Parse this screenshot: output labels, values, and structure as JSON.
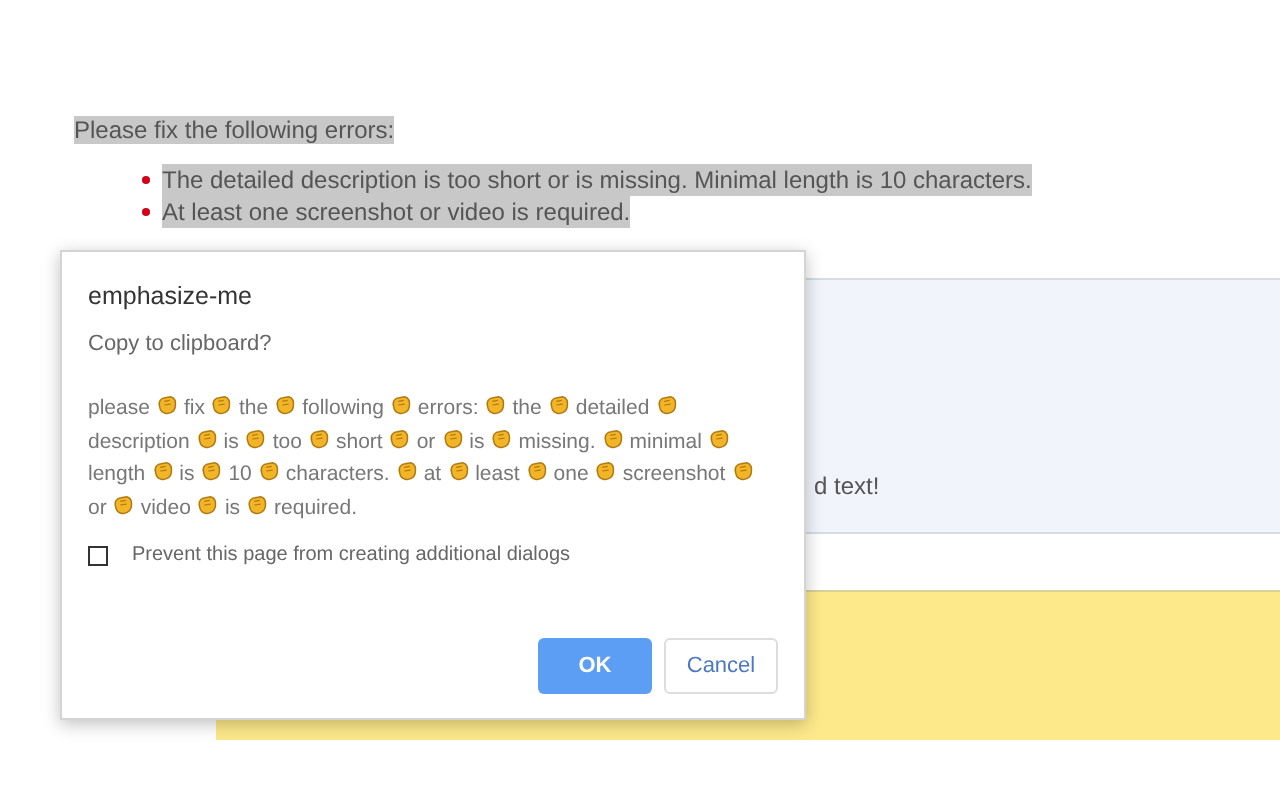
{
  "page": {
    "heading": "Please fix the following errors:",
    "errors": [
      "The detailed description is too short or is missing. Minimal length is 10 characters.",
      "At least one screenshot or video is required."
    ],
    "panel_text": "d text!"
  },
  "dialog": {
    "title": "emphasize-me",
    "question": "Copy to clipboard?",
    "message_words": [
      "please",
      "fix",
      "the",
      "following",
      "errors:",
      "the",
      "detailed",
      "description",
      "is",
      "too",
      "short",
      "or",
      "is",
      "missing.",
      "minimal",
      "length",
      "is",
      "10",
      "characters.",
      "at",
      "least",
      "one",
      "screenshot",
      "or",
      "video",
      "is",
      "required."
    ],
    "prevent_checkbox": {
      "label": "Prevent this page from creating additional dialogs",
      "checked": false
    },
    "buttons": [
      {
        "label": "OK",
        "kind": "primary"
      },
      {
        "label": "Cancel",
        "kind": "secondary"
      }
    ]
  }
}
